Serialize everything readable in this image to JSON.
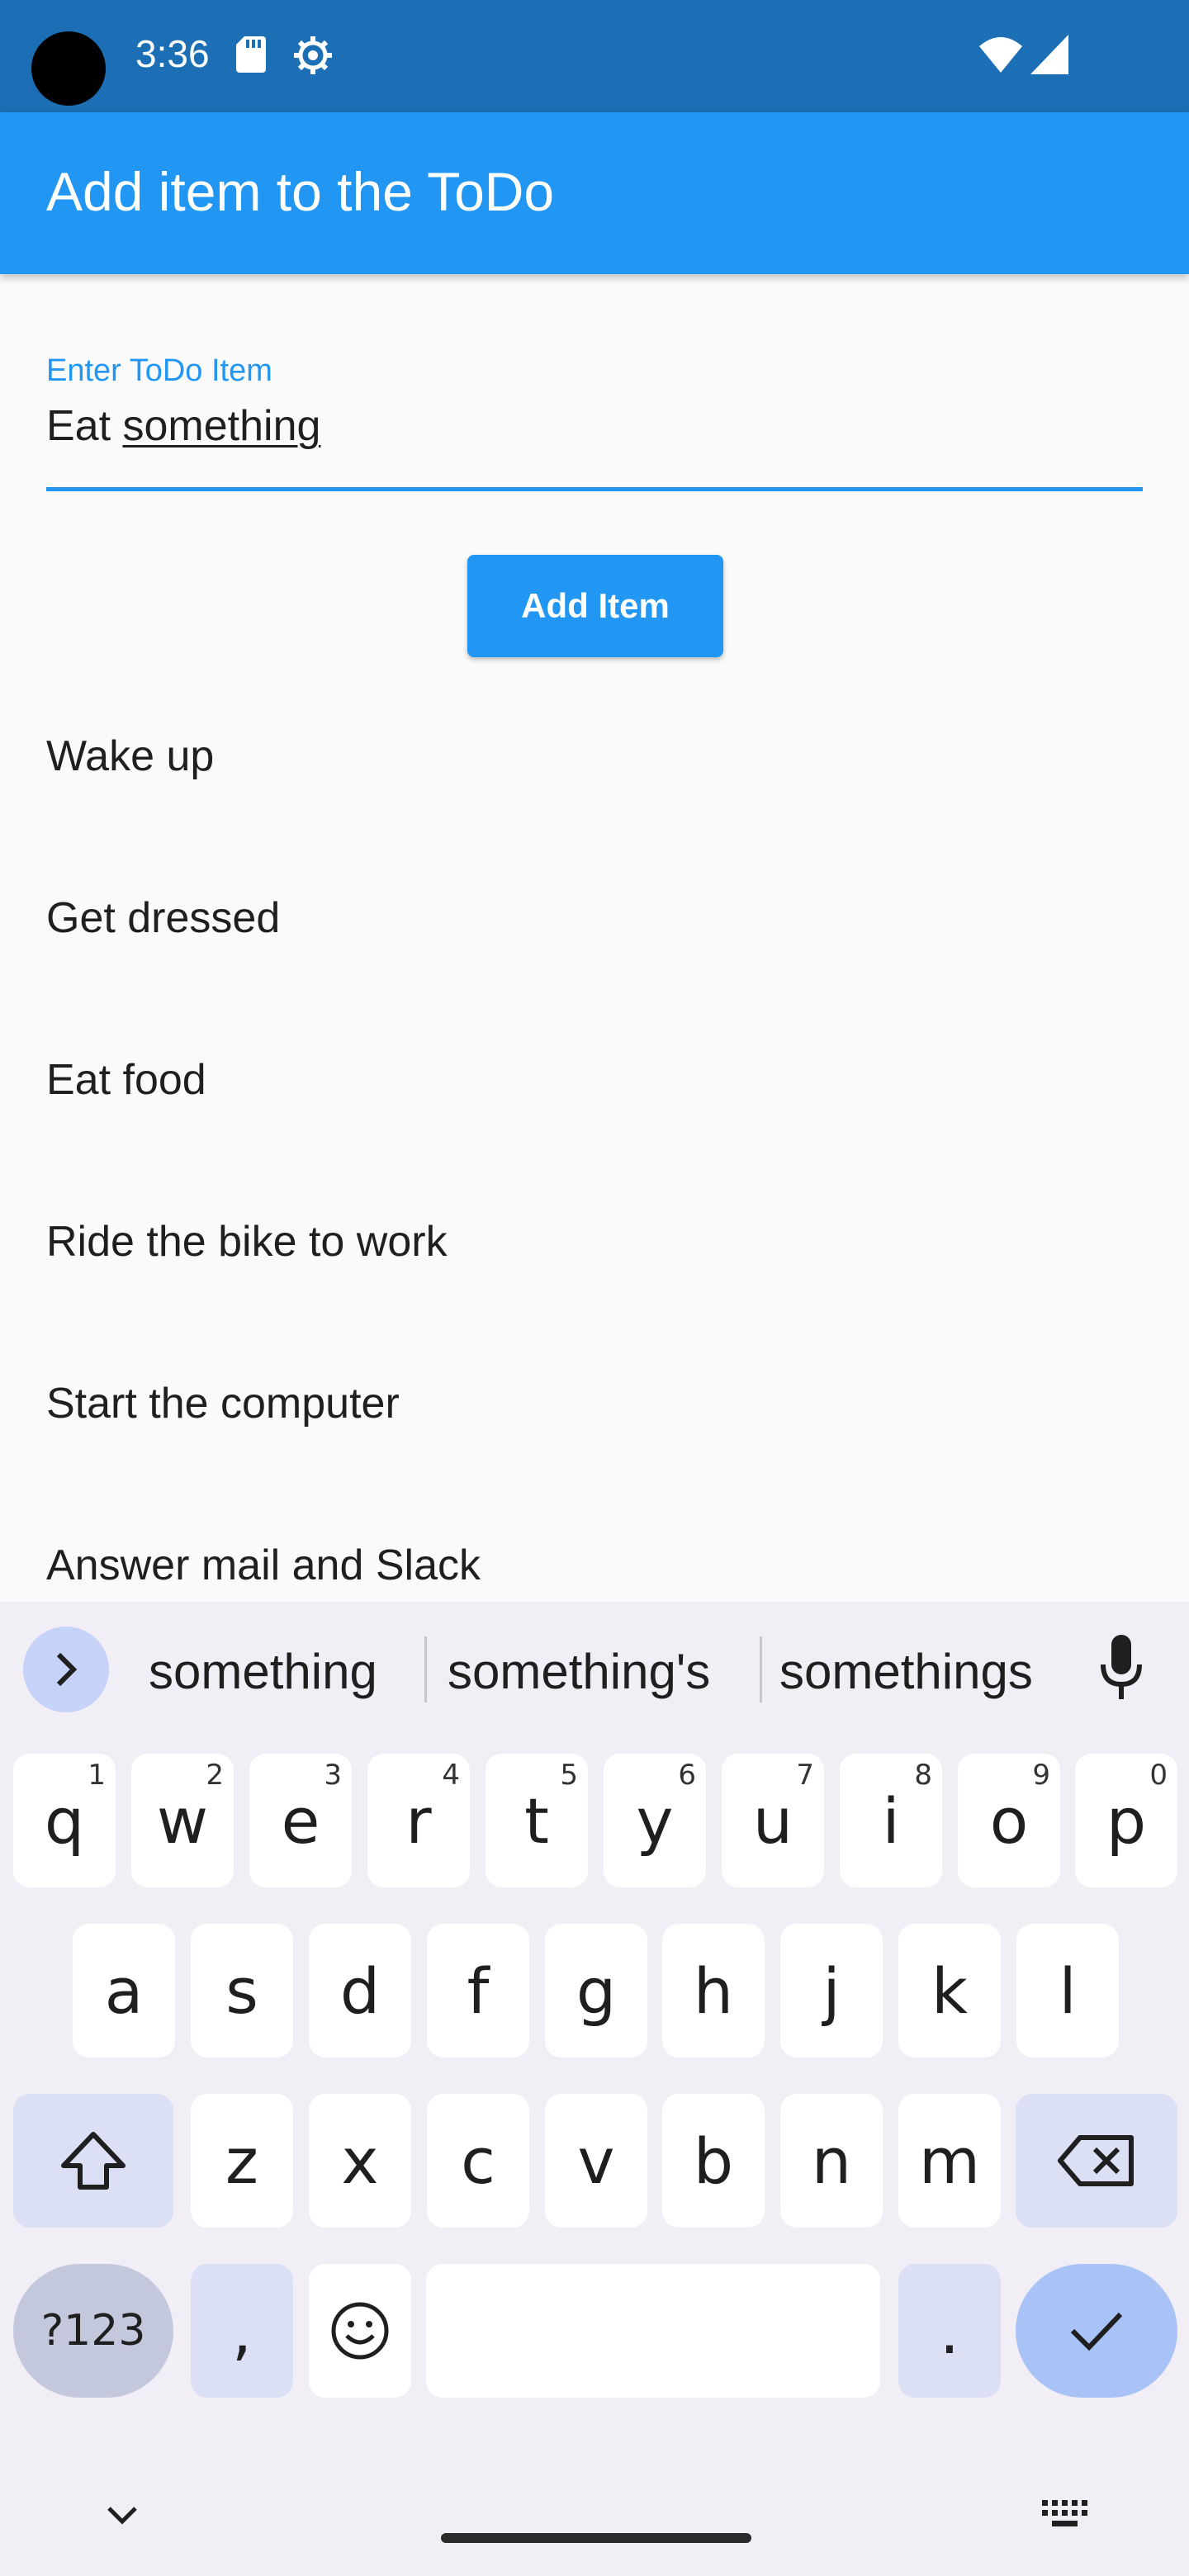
{
  "status_bar": {
    "time": "3:36",
    "icons": [
      "sd-card-icon",
      "settings-gear-icon",
      "wifi-icon",
      "cell-signal-icon"
    ]
  },
  "app_bar": {
    "title": "Add item to the ToDo"
  },
  "input": {
    "label": "Enter ToDo Item",
    "value_prefix": "Eat ",
    "value_composing": "something"
  },
  "add_button": {
    "label": "Add Item"
  },
  "todo_items": [
    "Wake up",
    "Get dressed",
    "Eat food",
    "Ride the bike to work",
    "Start the computer",
    "Answer mail and Slack"
  ],
  "keyboard": {
    "suggestions": [
      "something",
      "something's",
      "somethings"
    ],
    "row1": [
      {
        "k": "q",
        "h": "1"
      },
      {
        "k": "w",
        "h": "2"
      },
      {
        "k": "e",
        "h": "3"
      },
      {
        "k": "r",
        "h": "4"
      },
      {
        "k": "t",
        "h": "5"
      },
      {
        "k": "y",
        "h": "6"
      },
      {
        "k": "u",
        "h": "7"
      },
      {
        "k": "i",
        "h": "8"
      },
      {
        "k": "o",
        "h": "9"
      },
      {
        "k": "p",
        "h": "0"
      }
    ],
    "row2": [
      "a",
      "s",
      "d",
      "f",
      "g",
      "h",
      "j",
      "k",
      "l"
    ],
    "row3": [
      "z",
      "x",
      "c",
      "v",
      "b",
      "n",
      "m"
    ],
    "symbols_key": "?123",
    "comma_key": ",",
    "period_key": ".",
    "colors": {
      "accent": "#2196f3",
      "enter": "#a9c3f7",
      "function_key": "#dbe0f5"
    }
  }
}
